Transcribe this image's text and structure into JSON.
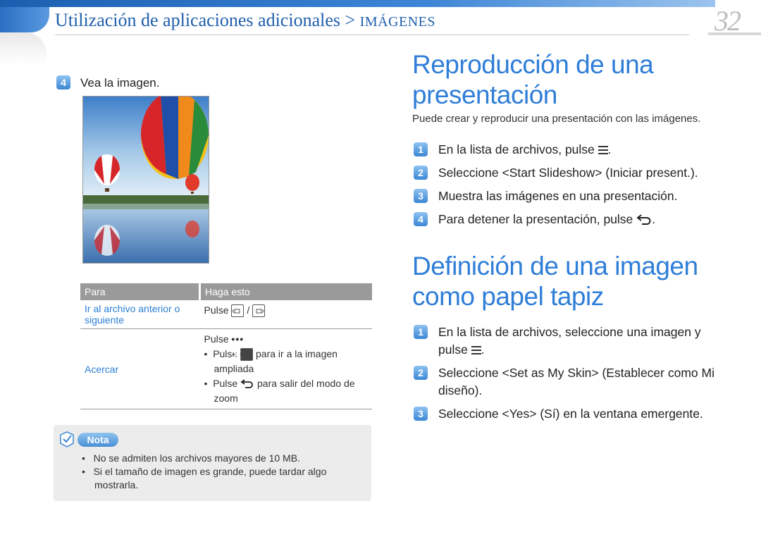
{
  "header": {
    "breadcrumb": "Utilización de aplicaciones adicionales >",
    "section": "IMÁGENES",
    "page_number": "32"
  },
  "left": {
    "step4": {
      "number": "4",
      "text": "Vea la imagen."
    },
    "table": {
      "col_para": "Para",
      "col_haga": "Haga esto",
      "rows": [
        {
          "para": "Ir al archivo anterior o siguiente",
          "pulse": "Pulse",
          "sep": "/"
        },
        {
          "para": "Acercar",
          "pulse": "Pulse",
          "b1_pulse": "Pulse",
          "b1_rest": "para ir a la imagen ampliada",
          "b2_pulse": "Pulse",
          "b2_rest": "para salir del modo de zoom"
        }
      ]
    },
    "nota": {
      "label": "Nota",
      "items": [
        "No se admiten los archivos mayores de 10 MB.",
        "Si el tamaño de imagen es grande, puede tardar algo mostrarla."
      ]
    }
  },
  "right": {
    "section1": {
      "title_line1": "Reproducción de una",
      "title_line2": "presentación",
      "intro": "Puede crear y reproducir una presentación con las imágenes.",
      "steps": [
        {
          "n": "1",
          "text": "En la lista de archivos, pulse",
          "end": "."
        },
        {
          "n": "2",
          "text": "Seleccione <Start Slideshow> (Iniciar present.)."
        },
        {
          "n": "3",
          "text": "Muestra las imágenes en una presentación."
        },
        {
          "n": "4",
          "text": "Para detener la presentación, pulse",
          "end": "."
        }
      ]
    },
    "section2": {
      "title_line1": "Definición de una imagen",
      "title_line2": "como papel tapiz",
      "steps": [
        {
          "n": "1",
          "text": "En la lista de archivos, seleccione una imagen y pulse",
          "end": "."
        },
        {
          "n": "2",
          "text": "Seleccione <Set as My Skin> (Establecer como Mi diseño)."
        },
        {
          "n": "3",
          "text": "Seleccione <Yes> (Sí) en la ventana emergente."
        }
      ]
    }
  }
}
